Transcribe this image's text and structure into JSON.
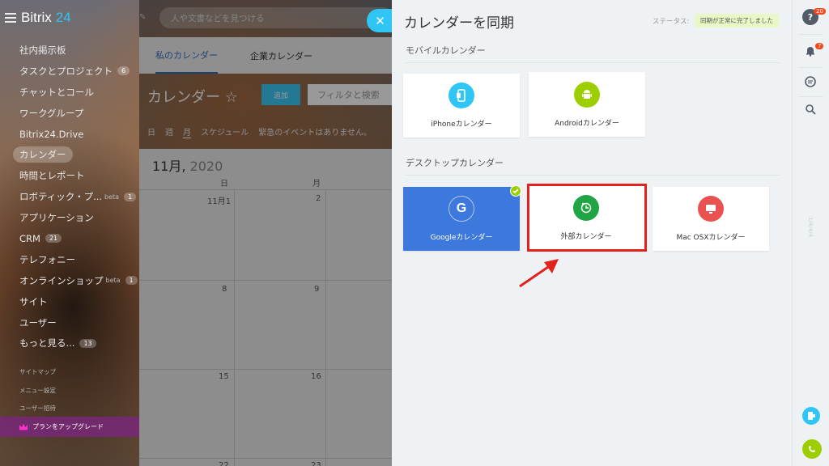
{
  "brand": {
    "name_a": "Bitrix",
    "name_b": "24"
  },
  "search": {
    "placeholder": "人や文書などを見つける"
  },
  "sidebar": {
    "items": [
      {
        "label": "社内掲示板"
      },
      {
        "label": "タスクとプロジェクト",
        "counter": "6"
      },
      {
        "label": "チャットとコール"
      },
      {
        "label": "ワークグループ"
      },
      {
        "label": "Bitrix24.Drive"
      },
      {
        "label": "カレンダー",
        "active": true
      },
      {
        "label": "時間とレポート"
      },
      {
        "label": "ロボティック・プ...",
        "beta": "beta",
        "counter": "1"
      },
      {
        "label": "アプリケーション"
      },
      {
        "label": "CRM",
        "counter": "21"
      },
      {
        "label": "テレフォニー"
      },
      {
        "label": "オンラインショップ",
        "beta": "beta",
        "counter": "1"
      },
      {
        "label": "サイト"
      },
      {
        "label": "ユーザー"
      },
      {
        "label": "もっと見る...",
        "counter": "13"
      }
    ],
    "minor_links": [
      "サイトマップ",
      "メニュー設定",
      "ユーザー招待"
    ],
    "upgrade_label": "プランをアップグレード"
  },
  "calendar": {
    "tabs": [
      "私のカレンダー",
      "企業カレンダー"
    ],
    "title": "カレンダー ☆",
    "add_label": "追加",
    "filter_placeholder": "フィルタと検索",
    "views": [
      "日",
      "週",
      "月",
      "スケジュール"
    ],
    "no_events": "緊急のイベントはありません。",
    "month": "11月,",
    "year": "2020",
    "weekdays": [
      "日",
      "月"
    ],
    "dates": [
      "11月1",
      "2",
      "8",
      "9",
      "15",
      "16",
      "22",
      "23"
    ]
  },
  "panel": {
    "title": "カレンダーを同期",
    "status_label": "ステータス:",
    "status_value": "同期が正常に完了しました",
    "mobile_section": "モバイルカレンダー",
    "desktop_section": "デスクトップカレンダー",
    "mobile_cards": [
      {
        "label": "iPhoneカレンダー",
        "icon": "iphone-icon",
        "color": "#2fc6f6"
      },
      {
        "label": "Androidカレンダー",
        "icon": "android-icon",
        "color": "#9dcf00"
      }
    ],
    "desktop_cards": [
      {
        "label": "Googleカレンダー",
        "icon": "google-icon",
        "color": "#3d78dc",
        "connected": true
      },
      {
        "label": "外部カレンダー",
        "icon": "external-calendar-icon",
        "color": "#21a544"
      },
      {
        "label": "Mac OSXカレンダー",
        "icon": "mac-icon",
        "color": "#ea5252"
      }
    ]
  },
  "rightbar": {
    "help_badge": "20",
    "notify_badge": "7",
    "vertical_text": "1/4/4/4"
  },
  "colors": {
    "accent": "#2fc6f6",
    "highlight": "#e2221d"
  }
}
